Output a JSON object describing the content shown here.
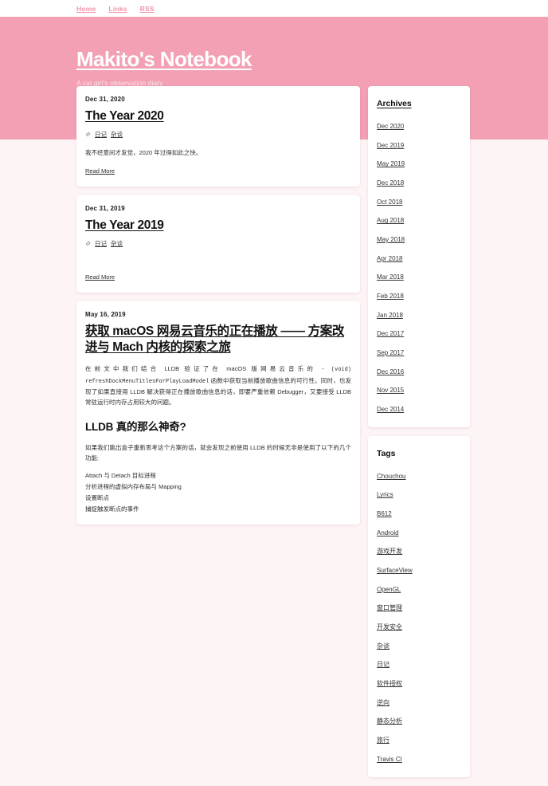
{
  "nav": {
    "links": [
      {
        "label": "Home"
      },
      {
        "label": "Links"
      },
      {
        "label": "RSS"
      }
    ]
  },
  "hero": {
    "title": "Makito's Notebook",
    "subtitle": "A cat girl's observation diary",
    "background_color": "#f3a0b4",
    "title_color": "#ffffff"
  },
  "posts": [
    {
      "date": "Dec 31, 2020",
      "title": "The Year 2020",
      "tag_icon": "tag-icon",
      "tags": [
        "日记",
        "杂谈"
      ],
      "excerpt": "我不经意间才发觉，2020 年过得如此之快。",
      "read_more": "Read More"
    },
    {
      "date": "Dec 31, 2019",
      "title": "The Year 2019",
      "tag_icon": "tag-icon",
      "tags": [
        "日记",
        "杂谈"
      ],
      "excerpt": "",
      "read_more": "Read More"
    },
    {
      "date": "May 16, 2019",
      "title": "获取 macOS 网易云音乐的正在播放 —— 方案改进与 Mach 内核的探索之旅",
      "excerpt_part1": "在前文中我们结合 LLDB 验证了在 macOS 版网易云音乐的 ",
      "excerpt_code": "- (void) refreshDockMenuTitlesForPlayLoadModel",
      "excerpt_part2": " 函数中获取当前播放歌曲信息的可行性。同时，也发现了如果直接用 LLDB 解决获得正在播放歌曲信息的话，即要严重依赖 Debugger，又要接受 LLDB 常驻运行时内存占用较大的问题。",
      "heading": "LLDB 真的那么神奇?",
      "paragraph": "如果我们跳出盒子重新思考这个方案的话，就会发现之前使用 LLDB 的时候无非是使用了以下的几个功能:",
      "list": [
        "Attach 与 Detach 目标进程",
        "分析进程的虚拟内存布局与 Mapping",
        "设置断点",
        "捕捉触发断点的事件"
      ]
    }
  ],
  "sidebar": {
    "archives": {
      "title": "Archives",
      "items": [
        "Dec 2020",
        "Dec 2019",
        "May 2019",
        "Dec 2018",
        "Oct 2018",
        "Aug 2018",
        "May 2018",
        "Apr 2018",
        "Mar 2018",
        "Feb 2018",
        "Jan 2018",
        "Dec 2017",
        "Sep 2017",
        "Dec 2016",
        "Nov 2015",
        "Dec 2014"
      ]
    },
    "tags": {
      "title": "Tags",
      "items": [
        "Chouchou",
        "Lyrics",
        "B612",
        "Android",
        "游戏开发",
        "SurfaceView",
        "OpenGL",
        "窗口管理",
        "开发安全",
        "杂谈",
        "日记",
        "软件授权",
        "逆向",
        "静态分析",
        "旅行",
        "Travis CI"
      ]
    }
  }
}
